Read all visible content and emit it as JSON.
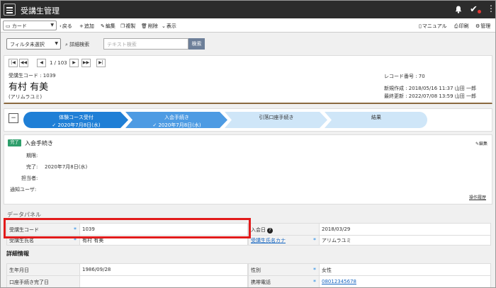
{
  "app": {
    "title": "受講生管理"
  },
  "toolbar": {
    "view_select": "カード",
    "back": "戻る",
    "add": "追加",
    "edit": "編集",
    "copy": "複製",
    "delete": "削除",
    "display": "表示",
    "manual": "マニュアル",
    "print": "印刷",
    "admin": "管理"
  },
  "filter": {
    "select": "フィルタ未選択",
    "advanced_search": "詳細検索",
    "text_placeholder": "テキスト検索",
    "search_button": "検索"
  },
  "record": {
    "pager": "1 / 103",
    "code_label": "受講生コード : 1039",
    "name": "有村 有美",
    "kana": "(アリムラユミ)",
    "record_no": "レコード番号 : 70",
    "created": "新規作成 : 2018/05/16 11:37 山田 一郎",
    "updated": "最終更新 : 2022/07/08 13:59 山田 一郎"
  },
  "process": {
    "steps": [
      {
        "label": "体験コース受付",
        "date": "2020年7月8日(水)",
        "color": "#1f7fd6",
        "text_color": "#ffffff"
      },
      {
        "label": "入会手続き",
        "date": "2020年7月8日(水)",
        "color": "#4d9be3",
        "text_color": "#ffffff"
      },
      {
        "label": "引落口座手続き",
        "date": "",
        "color": "#cfe6f8",
        "text_color": "#333333"
      },
      {
        "label": "結果",
        "date": "",
        "color": "#cfe6f8",
        "text_color": "#333333"
      }
    ]
  },
  "detail": {
    "badge": "完了",
    "title": "入会手続き",
    "edit": "編集",
    "period_label": "期限:",
    "done_label": "完了:",
    "done_value": "2020年7月8日(水)",
    "assignee_label": "担当者:",
    "notify_label": "通知ユーザ:",
    "history": "操作履歴"
  },
  "panel": {
    "title": "データパネル",
    "rows": [
      {
        "l1": "受講生コード",
        "v1": "1039",
        "l2": "入会日",
        "v2": "2018/03/29"
      },
      {
        "l1": "受講生氏名",
        "v1": "有村 有美",
        "l2": "受講生氏名カナ",
        "v2": "アリムラユミ"
      }
    ],
    "section": "詳細情報",
    "detail_rows": [
      {
        "l1": "生年月日",
        "v1": "1986/09/28",
        "l2": "性別",
        "v2": "女性"
      },
      {
        "l1": "口座手続き完了日",
        "v1": "",
        "l2": "携帯電話",
        "v2": "08012345678"
      }
    ]
  }
}
